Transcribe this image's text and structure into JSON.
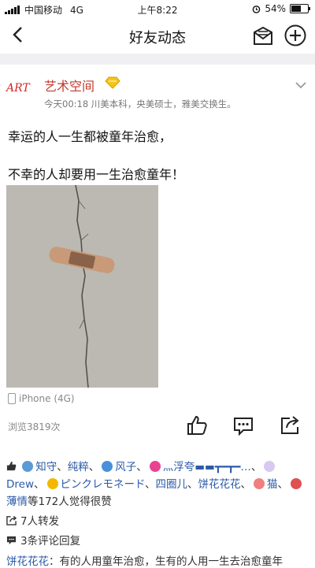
{
  "status_bar": {
    "carrier": "中国移动",
    "network": "4G",
    "time": "上午8:22",
    "battery": "54%"
  },
  "nav": {
    "title": "好友动态"
  },
  "post": {
    "author": "艺术空间",
    "avatar_text": "ART",
    "meta": "今天00:18  川美本科，央美硕士，雅美交换生。",
    "text_line1": "幸运的人一生都被童年治愈，",
    "text_line2": "不幸的人却要用一生治愈童年！",
    "device": "iPhone (4G)",
    "views": "浏览3819次"
  },
  "likes": {
    "names": [
      "知守",
      "纯粹",
      "风子",
      "灬浮夸▬▬┳━┳━…",
      "Drew",
      "ピンクレモネード",
      "四圈儿",
      "饼花花花",
      "猫",
      "薄情"
    ],
    "separators": [
      "、",
      "、",
      "、",
      "、",
      "、",
      "、",
      "、",
      "、",
      "、"
    ],
    "suffix": "等172人觉得很赞"
  },
  "repost_text": "7人转发",
  "comments_text": "3条评论回复",
  "comment_preview": {
    "name": "饼花花花",
    "text": "：有的人用童年治愈，生有的人用一生去治愈童年"
  },
  "colors": {
    "accent": "#2b5aa8",
    "author": "#c0392b"
  }
}
